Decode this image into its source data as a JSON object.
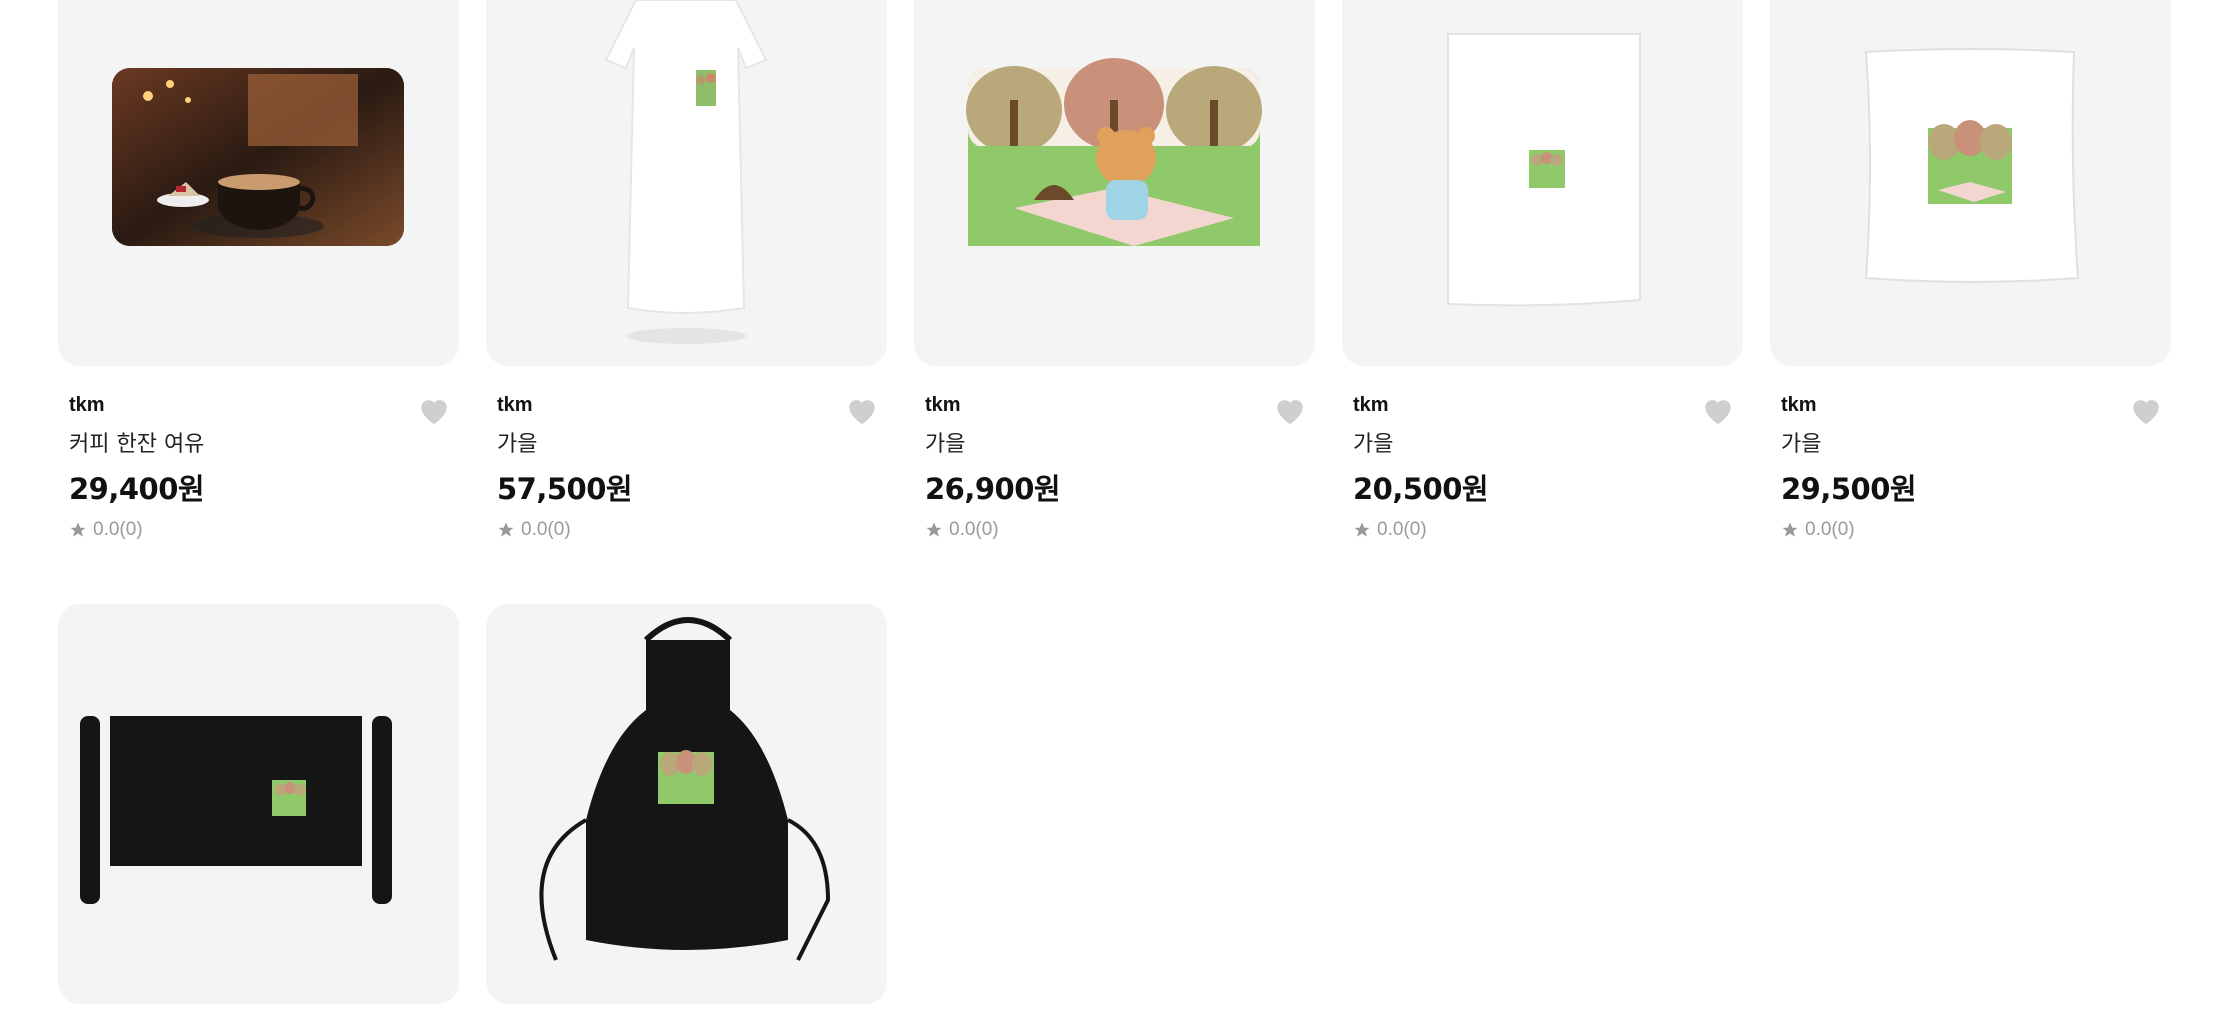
{
  "products": [
    {
      "seller": "tkm",
      "title": "커피 한잔 여유",
      "price": "29,400원",
      "rating": "0.0",
      "reviews": "(0)",
      "image_icon": "coffee-mousepad-icon"
    },
    {
      "seller": "tkm",
      "title": "가을",
      "price": "57,500원",
      "rating": "0.0",
      "reviews": "(0)",
      "image_icon": "white-tshirt-dress-icon"
    },
    {
      "seller": "tkm",
      "title": "가을",
      "price": "26,900원",
      "rating": "0.0",
      "reviews": "(0)",
      "image_icon": "bear-picnic-mousepad-icon"
    },
    {
      "seller": "tkm",
      "title": "가을",
      "price": "20,500원",
      "rating": "0.0",
      "reviews": "(0)",
      "image_icon": "white-towel-icon"
    },
    {
      "seller": "tkm",
      "title": "가을",
      "price": "29,500원",
      "rating": "0.0",
      "reviews": "(0)",
      "image_icon": "white-cushion-icon"
    }
  ],
  "row2": [
    {
      "image_icon": "black-waist-apron-icon"
    },
    {
      "image_icon": "black-full-apron-icon"
    }
  ],
  "colors": {
    "card_bg": "#f4f4f4",
    "heart": "#cfcfcf",
    "star": "#9a9a9a",
    "text_primary": "#111111"
  }
}
